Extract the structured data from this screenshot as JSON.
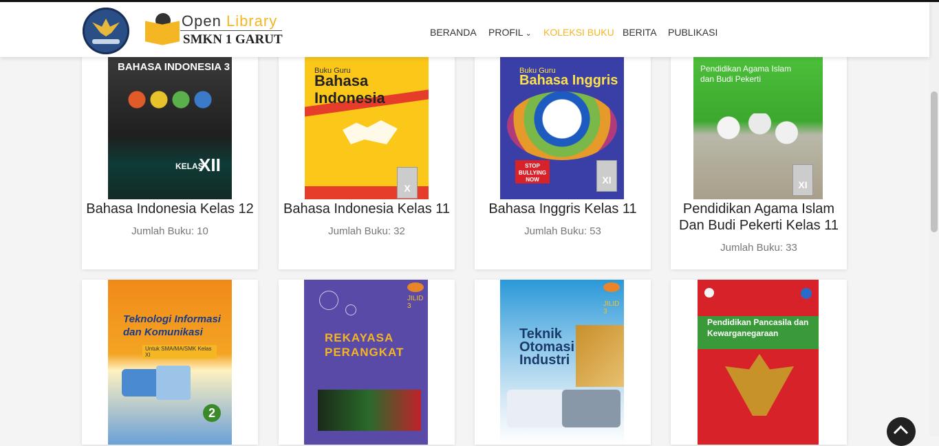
{
  "brand": {
    "open": "Open",
    "library": "Library",
    "school": "SMKN 1 GARUT"
  },
  "nav": [
    {
      "label": "BERANDA"
    },
    {
      "label": "PROFIL"
    },
    {
      "label": "KOLEKSI BUKU"
    },
    {
      "label": "BERITA"
    },
    {
      "label": "PUBLIKASI"
    }
  ],
  "colors": {
    "accent": "#f4b623",
    "text": "#222222",
    "muted": "#777777"
  },
  "books": [
    {
      "title": "Bahasa Indonesia Kelas 12",
      "count": "Jumlah Buku: 10",
      "cover": {
        "title": "BAHASA INDONESIA 3",
        "grade": "XII",
        "grade_prefix": "KELAS"
      }
    },
    {
      "title": "Bahasa Indonesia Kelas 11",
      "count": "Jumlah Buku: 32",
      "cover": {
        "top": "Buku Guru",
        "title": "Bahasa Indonesia",
        "grade": "X"
      }
    },
    {
      "title": "Bahasa Inggris Kelas 11",
      "count": "Jumlah Buku: 53",
      "cover": {
        "top": "Buku Guru",
        "title": "Bahasa Inggris",
        "grade": "XI",
        "tag": "STOP BULLYING NOW"
      }
    },
    {
      "title": "Pendidikan Agama Islam Dan Budi Pekerti Kelas 11",
      "title_line1": "Pendidikan Agama Islam",
      "title_line2": "Dan Budi Pekerti Kelas 11",
      "count": "Jumlah Buku: 33",
      "cover": {
        "title": "Pendidikan Agama Islam dan Budi Pekerti",
        "grade": "XI"
      }
    },
    {
      "cover": {
        "title": "Teknologi Informasi dan Komunikasi",
        "sub": "Untuk SMA/MA/SMK Kelas XI",
        "num": "2"
      }
    },
    {
      "cover": {
        "title": "REKAYASA PERANGKAT",
        "jilid": "JILID 3"
      }
    },
    {
      "cover": {
        "title": "Teknik Otomasi Industri",
        "jilid": "JILID 3"
      }
    },
    {
      "cover": {
        "title": "Pendidikan Pancasila dan Kewarganegaraan"
      }
    }
  ]
}
